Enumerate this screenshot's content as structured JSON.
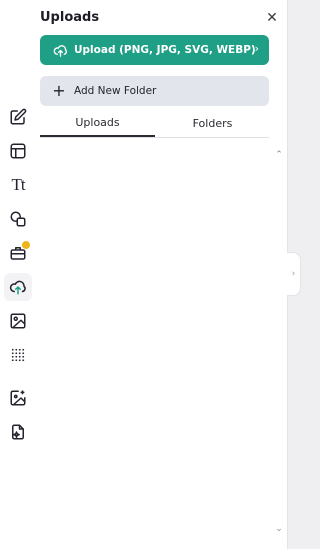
{
  "panel": {
    "title": "Uploads",
    "close_glyph": "✕",
    "upload_button": {
      "label": "Upload (PNG, JPG, SVG, WEBP)",
      "icon": "cloud-upload-icon",
      "chevron": "›"
    },
    "folder_button": {
      "label": "Add New Folder",
      "icon": "plus-icon",
      "glyph": "+"
    },
    "tabs": [
      {
        "label": "Uploads",
        "active": true
      },
      {
        "label": "Folders",
        "active": false
      }
    ],
    "scroll_up_glyph": "⌃",
    "scroll_down_glyph": "⌄",
    "collapse_glyph": "›"
  },
  "rail": {
    "items": [
      {
        "name": "edit-icon"
      },
      {
        "name": "layout-icon"
      },
      {
        "name": "text-icon",
        "glyph": "Tt"
      },
      {
        "name": "shapes-icon"
      },
      {
        "name": "toolbox-icon",
        "badge": true
      },
      {
        "name": "cloud-upload-icon",
        "active": true
      },
      {
        "name": "image-icon"
      },
      {
        "name": "dots-pattern-icon"
      },
      {
        "name": "magic-image-icon"
      },
      {
        "name": "magic-file-icon"
      }
    ]
  },
  "colors": {
    "accent": "#1fa086",
    "secondary_button": "#e3e5ec",
    "badge": "#f1b418"
  }
}
